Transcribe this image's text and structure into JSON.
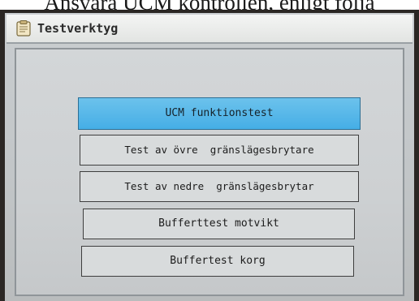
{
  "caption": {
    "text": "Ansvara UCM kontrollen, enligt följa"
  },
  "window": {
    "title": "Testverktyg",
    "icon": "clipboard-icon"
  },
  "menu": {
    "items": [
      {
        "label": "UCM funktionstest",
        "selected": true
      },
      {
        "label": "Test av övre  gränslägesbrytare",
        "selected": false
      },
      {
        "label": "Test av nedre  gränslägesbrytar",
        "selected": false
      },
      {
        "label": "Bufferttest motvikt",
        "selected": false
      },
      {
        "label": "Buffertest korg",
        "selected": false
      }
    ]
  },
  "colors": {
    "selected_item": "#45aee6",
    "screen_background": "#c9cdd0",
    "title_bar": "#eceeed",
    "device_frame": "#2b2724"
  }
}
